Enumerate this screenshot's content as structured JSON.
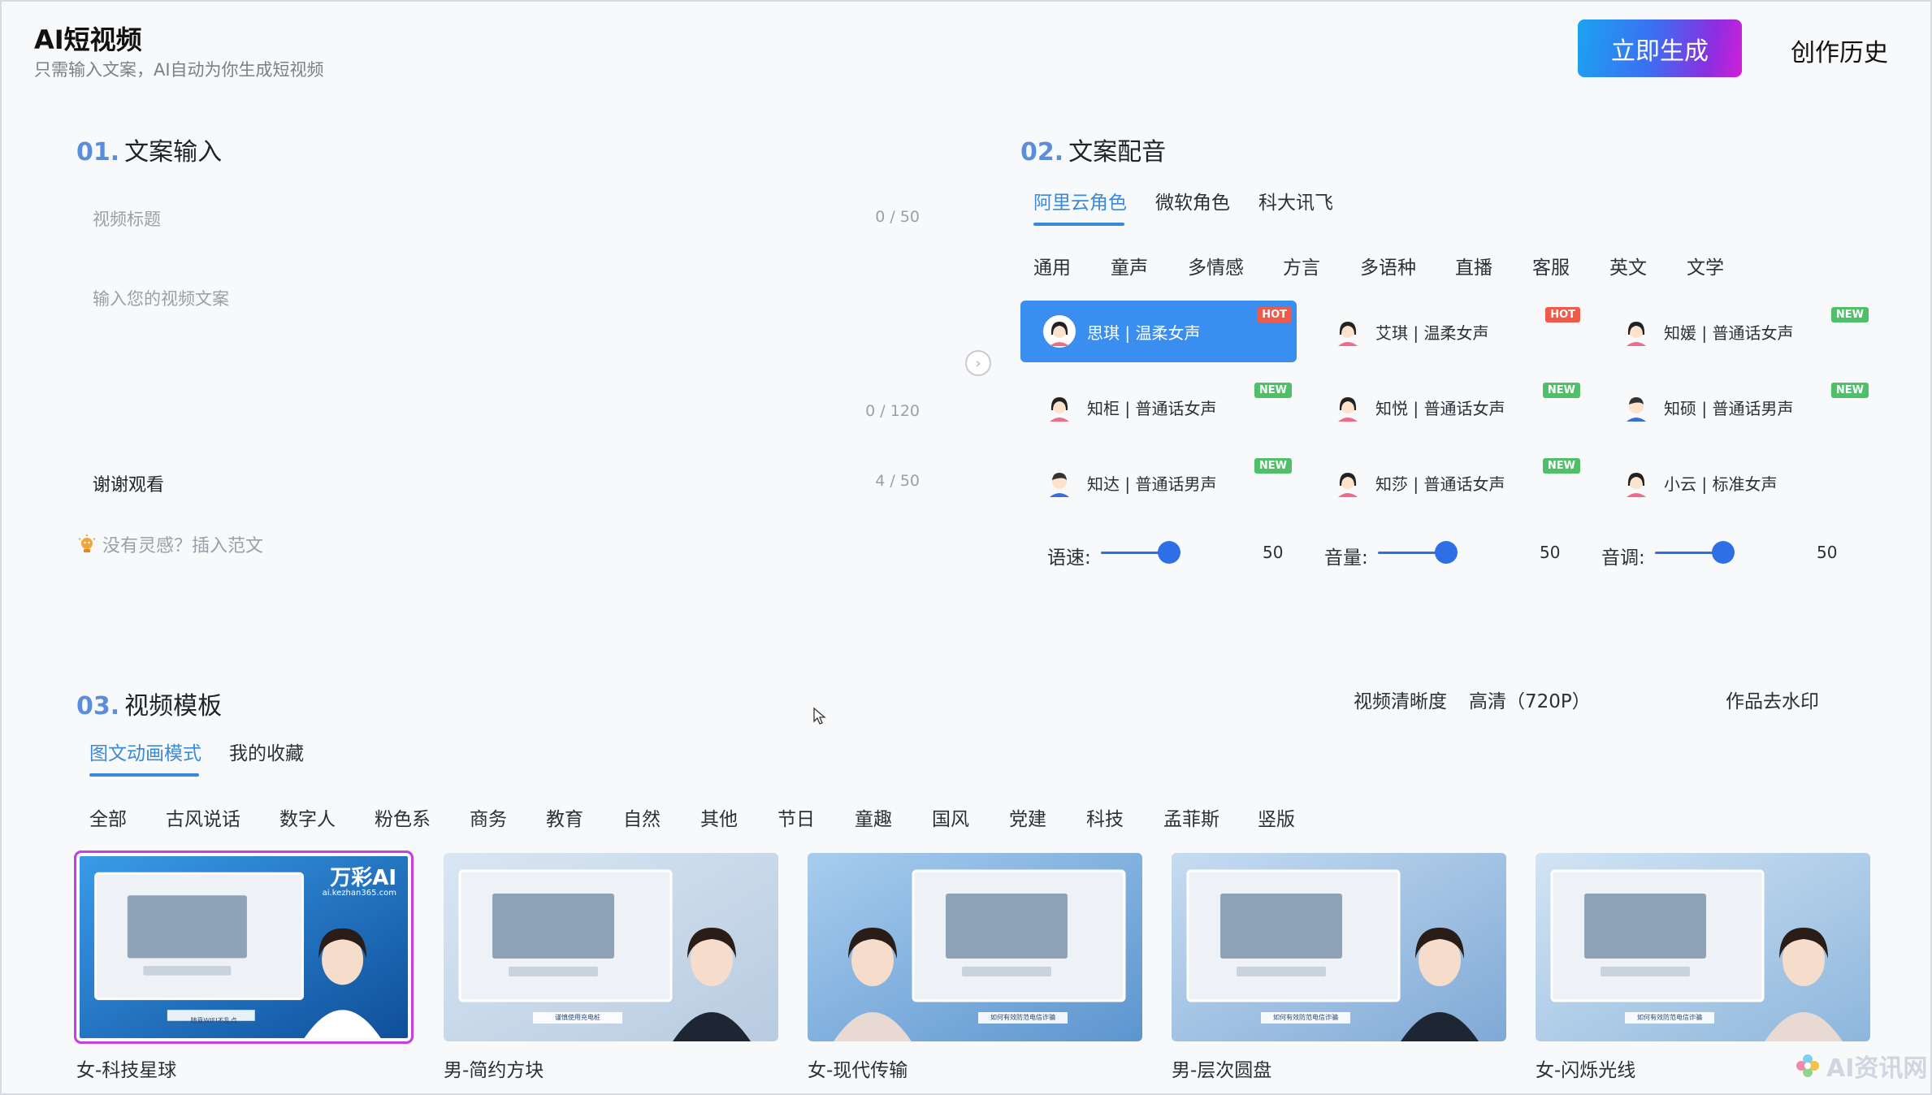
{
  "header": {
    "title": "AI短视频",
    "subtitle": "只需输入文案，AI自动为你生成短视频",
    "generate_label": "立即生成",
    "history_label": "创作历史"
  },
  "section1": {
    "num": "01.",
    "title": "文案输入",
    "title_placeholder": "视频标题",
    "title_count": "0 / 50",
    "body_placeholder": "输入您的视频文案",
    "body_count": "0 / 120",
    "ending_value": "谢谢观看",
    "ending_count": "4 / 50",
    "hint": "没有灵感？插入范文"
  },
  "section2": {
    "num": "02.",
    "title": "文案配音",
    "providers": [
      "阿里云角色",
      "微软角色",
      "科大讯飞"
    ],
    "active_provider": "阿里云角色",
    "categories": [
      "通用",
      "童声",
      "多情感",
      "方言",
      "多语种",
      "直播",
      "客服",
      "英文",
      "文学"
    ],
    "voices": [
      {
        "name": "思琪 | 温柔女声",
        "badge": "HOT",
        "gender": "female",
        "selected": true
      },
      {
        "name": "艾琪 | 温柔女声",
        "badge": "HOT",
        "gender": "female",
        "selected": false
      },
      {
        "name": "知媛 | 普通话女声",
        "badge": "NEW",
        "gender": "female",
        "selected": false
      },
      {
        "name": "知柜 | 普通话女声",
        "badge": "NEW",
        "gender": "female",
        "selected": false
      },
      {
        "name": "知悦 | 普通话女声",
        "badge": "NEW",
        "gender": "female",
        "selected": false
      },
      {
        "name": "知硕 | 普通话男声",
        "badge": "NEW",
        "gender": "male",
        "selected": false
      },
      {
        "name": "知达 | 普通话男声",
        "badge": "NEW",
        "gender": "male",
        "selected": false
      },
      {
        "name": "知莎 | 普通话女声",
        "badge": "NEW",
        "gender": "female",
        "selected": false
      },
      {
        "name": "小云 | 标准女声",
        "badge": "",
        "gender": "female",
        "selected": false
      }
    ],
    "sliders": [
      {
        "label": "语速:",
        "value": "50"
      },
      {
        "label": "音量:",
        "value": "50"
      },
      {
        "label": "音调:",
        "value": "50"
      }
    ]
  },
  "section3": {
    "num": "03.",
    "title": "视频模板",
    "resolution_label": "视频清晰度",
    "resolution_value": "高清（720P）",
    "watermark_label": "作品去水印",
    "tabs": [
      "图文动画模式",
      "我的收藏"
    ],
    "active_tab": "图文动画模式",
    "categories": [
      "全部",
      "古风说话",
      "数字人",
      "粉色系",
      "商务",
      "教育",
      "自然",
      "其他",
      "节日",
      "童趣",
      "国风",
      "党建",
      "科技",
      "孟菲斯",
      "竖版"
    ],
    "templates": [
      {
        "caption": "女-科技星球",
        "selected": true,
        "brand": "万彩AI",
        "brand_url": "ai.kezhan365.com",
        "banner": "随意WIFI不乱点"
      },
      {
        "caption": "男-简约方块",
        "selected": false,
        "banner": "谨慎使用充电桩"
      },
      {
        "caption": "女-现代传输",
        "selected": false,
        "banner": "如何有效防范电信诈骗"
      },
      {
        "caption": "男-层次圆盘",
        "selected": false,
        "banner": "如何有效防范电信诈骗"
      },
      {
        "caption": "女-闪烁光线",
        "selected": false,
        "banner": "如何有效防范电信诈骗"
      }
    ]
  },
  "watermark": "AI资讯网",
  "colors": {
    "accent": "#3b8ad9",
    "selected_card": "#3a8ef0",
    "hot": "#f05a4a",
    "new": "#4fbf6a",
    "section_number": "#5b8ddb"
  }
}
